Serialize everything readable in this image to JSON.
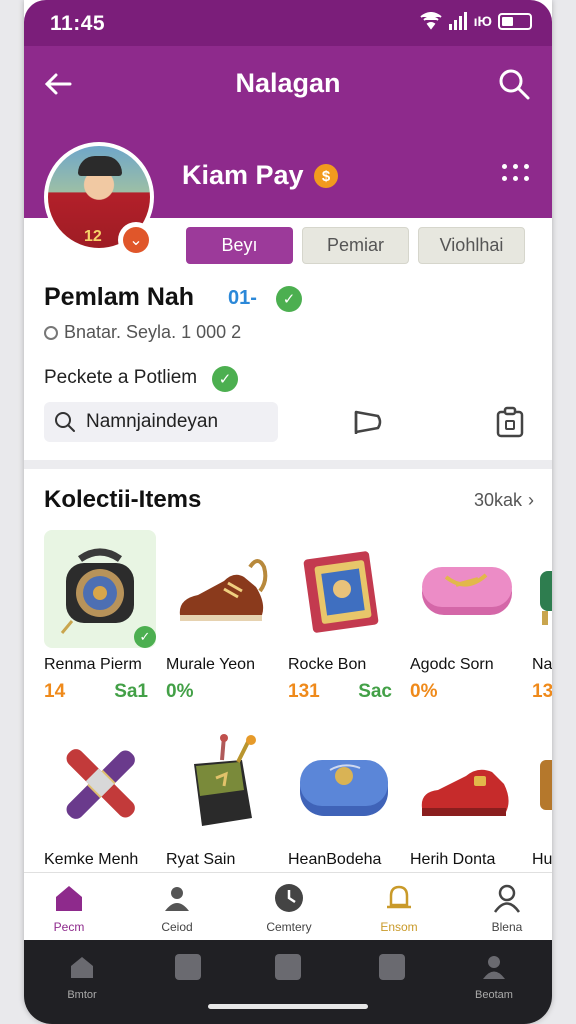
{
  "status_bar": {
    "time": "11:45",
    "net_label": "ıЮ"
  },
  "app_bar": {
    "title": "Nalagan"
  },
  "profile": {
    "display_name": "Kiam Pay",
    "avatar_number": "12",
    "tabs": [
      "Beyı",
      "Pemiar",
      "Viohlhai"
    ]
  },
  "user": {
    "name": "Pemlam Nah",
    "id": "01-",
    "status": "Bnatar. Seyla. 1 000  2",
    "promo": "Peckete a Potliem"
  },
  "search": {
    "value": "Namnjaindeyan"
  },
  "collection": {
    "title": "Kolectii-Items",
    "view_all": "30kak",
    "items": [
      {
        "name": "Renma Pierm",
        "left": "14",
        "right": "Sa1",
        "left_color": "orange",
        "right_color": "green",
        "selected": true,
        "icon": "compass-bag-icon"
      },
      {
        "name": "Murale Yeon",
        "left": "0%",
        "right": "",
        "left_color": "green",
        "right_color": "green",
        "selected": false,
        "icon": "shoe-icon"
      },
      {
        "name": "Rocke Bon",
        "left": "131",
        "right": "Sac",
        "left_color": "orange",
        "right_color": "green",
        "selected": false,
        "icon": "book-icon"
      },
      {
        "name": "Agodc Sorn",
        "left": "0%",
        "right": "",
        "left_color": "orange",
        "right_color": "orange",
        "selected": false,
        "icon": "pink-box-icon"
      },
      {
        "name": "Na",
        "left": "13",
        "right": "",
        "left_color": "orange",
        "right_color": "orange",
        "selected": false,
        "icon": "partial-item-icon"
      },
      {
        "name": "Kemke Menh",
        "left": "",
        "right": "",
        "selected": false,
        "icon": "crossed-sticks-icon"
      },
      {
        "name": "Ryat Sain",
        "left": "",
        "right": "",
        "selected": false,
        "icon": "bucket-icon"
      },
      {
        "name": "HeanBodeha",
        "left": "",
        "right": "",
        "selected": false,
        "icon": "blue-case-icon"
      },
      {
        "name": "Herih Donta",
        "left": "",
        "right": "",
        "selected": false,
        "icon": "red-shoe-icon"
      },
      {
        "name": "Hu",
        "left": "",
        "right": "",
        "selected": false,
        "icon": "partial-item-icon"
      }
    ]
  },
  "bottom_nav": [
    {
      "label": "Pecm",
      "icon": "home-icon",
      "active": true
    },
    {
      "label": "Ceiod",
      "icon": "people-icon",
      "active": false
    },
    {
      "label": "Cemtery",
      "icon": "clock-icon",
      "active": false
    },
    {
      "label": "Ensom",
      "icon": "bell-icon",
      "active": false
    },
    {
      "label": "Blena",
      "icon": "person-icon",
      "active": false
    }
  ],
  "system_nav": [
    {
      "label": "Bmtor",
      "icon": "home-icon"
    },
    {
      "label": "",
      "icon": "square-icon"
    },
    {
      "label": "",
      "icon": "thumb-icon"
    },
    {
      "label": "",
      "icon": "square-icon"
    },
    {
      "label": "Beotam",
      "icon": "person-icon"
    }
  ],
  "colors": {
    "primary": "#8e2a8c",
    "status_bar": "#7b1e7a",
    "accent_orange": "#ef8a1b",
    "accent_green": "#43a047"
  }
}
